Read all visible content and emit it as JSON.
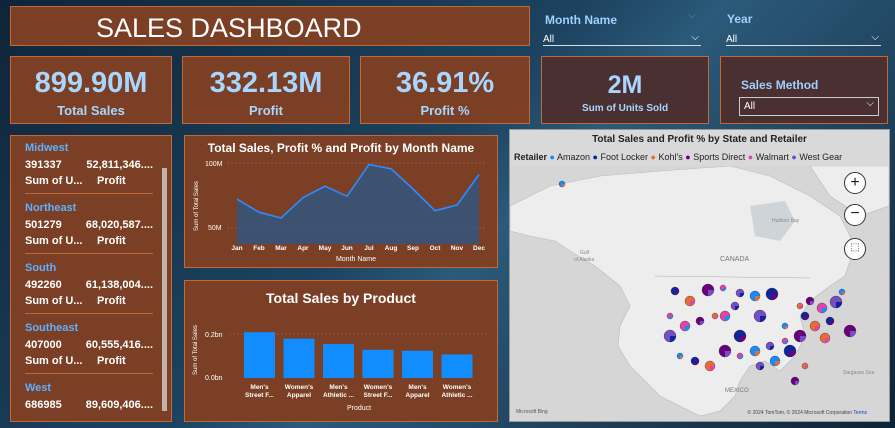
{
  "header": {
    "title": "SALES DASHBOARD"
  },
  "slicers": {
    "month": {
      "label": "Month Name",
      "value": "All"
    },
    "year": {
      "label": "Year",
      "value": "All"
    },
    "sales_method": {
      "label": "Sales Method",
      "value": "All"
    }
  },
  "kpis": [
    {
      "value": "899.90M",
      "label": "Total Sales"
    },
    {
      "value": "332.13M",
      "label": "Profit"
    },
    {
      "value": "36.91%",
      "label": "Profit %"
    },
    {
      "value": "2M",
      "label": "Sum of Units Sold"
    }
  ],
  "regions": [
    {
      "name": "Midwest",
      "units": "391337",
      "profit": "52,811,346....",
      "units_label": "Sum of U...",
      "profit_label": "Profit"
    },
    {
      "name": "Northeast",
      "units": "501279",
      "profit": "68,020,587....",
      "units_label": "Sum of U...",
      "profit_label": "Profit"
    },
    {
      "name": "South",
      "units": "492260",
      "profit": "61,138,004....",
      "units_label": "Sum of U...",
      "profit_label": "Profit"
    },
    {
      "name": "Southeast",
      "units": "407000",
      "profit": "60,555,416....",
      "units_label": "Sum of U...",
      "profit_label": "Profit"
    },
    {
      "name": "West",
      "units": "686985",
      "profit": "89,609,406....",
      "units_label": "",
      "profit_label": ""
    }
  ],
  "line_chart": {
    "title": "Total Sales, Profit % and Profit by Month Name",
    "ylabel": "Sum of Total Sales",
    "xlabel": "Month Name",
    "ytick_top": "100M",
    "ytick_bottom": "50M"
  },
  "bar_chart": {
    "title": "Total Sales by Product",
    "ylabel": "Sum of Total Sales",
    "xlabel": "Product",
    "ytick_top": "0.2bn",
    "ytick_bottom": "0.0bn",
    "labels": [
      [
        "Men's",
        "Street F..."
      ],
      [
        "Women's",
        "Apparel"
      ],
      [
        "Men's",
        "Athletic ..."
      ],
      [
        "Women's",
        "Street F..."
      ],
      [
        "Men's",
        "Apparel"
      ],
      [
        "Women's",
        "Athletic ..."
      ]
    ]
  },
  "map": {
    "title": "Total Sales and Profit % by State and Retailer",
    "legend_title": "Retailer",
    "legend": [
      {
        "name": "Amazon",
        "color": "#118dff"
      },
      {
        "name": "Foot Locker",
        "color": "#12239e"
      },
      {
        "name": "Kohl's",
        "color": "#e66c37"
      },
      {
        "name": "Sports Direct",
        "color": "#6b007b"
      },
      {
        "name": "Walmart",
        "color": "#e044a7"
      },
      {
        "name": "West Gear",
        "color": "#744ec2"
      }
    ],
    "labels": {
      "canada": "CANADA",
      "gulf_alaska": "Gulf\nof Alaska",
      "hudson": "Hudson Bay",
      "labrador": "Labrador\nSea",
      "mexico": "MEXICO",
      "mexico_city": "Mexico\nCity",
      "sargasso": "Sargasso Sea"
    },
    "attribution": "© 2024 TomTom, © 2024 Microsoft Corporation",
    "terms": "Terms",
    "bing": "Microsoft Bing"
  },
  "chart_data": [
    {
      "type": "area",
      "title": "Total Sales, Profit % and Profit by Month Name",
      "xlabel": "Month Name",
      "ylabel": "Sum of Total Sales",
      "categories": [
        "Jan",
        "Feb",
        "Mar",
        "Apr",
        "May",
        "Jun",
        "Jul",
        "Aug",
        "Sep",
        "Oct",
        "Nov",
        "Dec"
      ],
      "series": [
        {
          "values": [
            71,
            62,
            58,
            72,
            80,
            73,
            95,
            92,
            78,
            63,
            67,
            88
          ]
        }
      ],
      "ylim": [
        40,
        105
      ]
    },
    {
      "type": "bar",
      "title": "Total Sales by Product",
      "xlabel": "Product",
      "ylabel": "Sum of Total Sales",
      "categories": [
        "Men's Street F...",
        "Women's Apparel",
        "Men's Athletic ...",
        "Women's Street F...",
        "Men's Apparel",
        "Women's Athletic ..."
      ],
      "values": [
        0.208,
        0.179,
        0.154,
        0.128,
        0.124,
        0.107
      ],
      "ylim": [
        0,
        0.25
      ]
    }
  ]
}
